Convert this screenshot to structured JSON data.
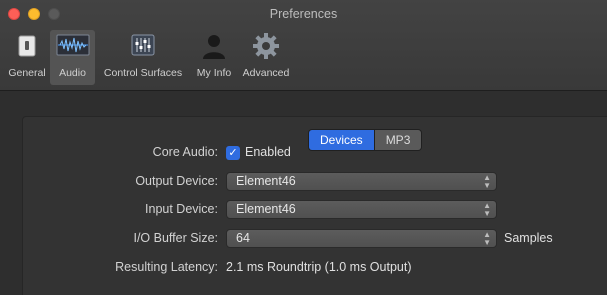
{
  "window": {
    "title": "Preferences"
  },
  "toolbar": {
    "items": [
      {
        "label": "General",
        "icon": "switch-icon"
      },
      {
        "label": "Audio",
        "icon": "audio-waveform-icon",
        "selected": true
      },
      {
        "label": "Control Surfaces",
        "icon": "mixer-faders-icon"
      },
      {
        "label": "My Info",
        "icon": "person-silhouette-icon"
      },
      {
        "label": "Advanced",
        "icon": "gear-icon"
      }
    ]
  },
  "tabs": {
    "devices": "Devices",
    "mp3": "MP3",
    "active": "Devices"
  },
  "settings": {
    "core_audio": {
      "label": "Core Audio:",
      "checkbox_label": "Enabled",
      "checked": true
    },
    "output_device": {
      "label": "Output Device:",
      "value": "Element46"
    },
    "input_device": {
      "label": "Input Device:",
      "value": "Element46"
    },
    "io_buffer": {
      "label": "I/O Buffer Size:",
      "value": "64",
      "unit": "Samples"
    },
    "latency": {
      "label": "Resulting Latency:",
      "value": "2.1 ms Roundtrip (1.0 ms Output)"
    }
  },
  "colors": {
    "accent": "#2f6ce0",
    "close": "#fc5f57",
    "minimize": "#fdbc2e"
  }
}
